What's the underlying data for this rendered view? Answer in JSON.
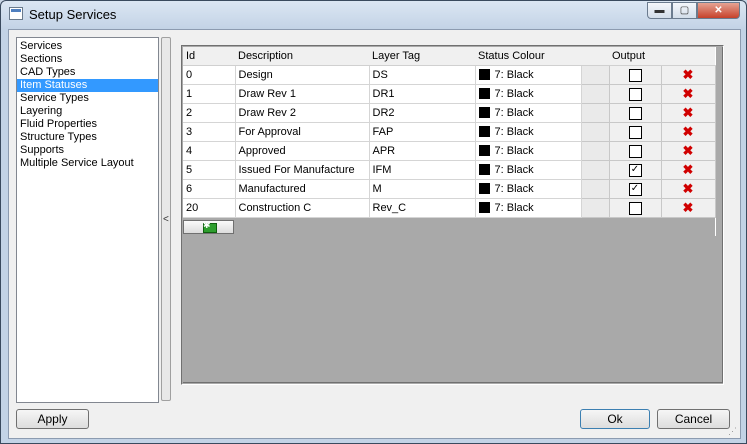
{
  "window": {
    "title": "Setup Services"
  },
  "caption": {
    "minimize": "▬",
    "maximize": "▢",
    "close": "✕"
  },
  "nav": {
    "items": [
      {
        "label": "Services",
        "selected": false
      },
      {
        "label": "Sections",
        "selected": false
      },
      {
        "label": "CAD Types",
        "selected": false
      },
      {
        "label": "Item Statuses",
        "selected": true
      },
      {
        "label": "Service Types",
        "selected": false
      },
      {
        "label": "Layering",
        "selected": false
      },
      {
        "label": "Fluid Properties",
        "selected": false
      },
      {
        "label": "Structure Types",
        "selected": false
      },
      {
        "label": "Supports",
        "selected": false
      },
      {
        "label": "Multiple Service Layout",
        "selected": false
      }
    ]
  },
  "splitter": {
    "glyph": "<"
  },
  "grid": {
    "headers": {
      "id": "Id",
      "description": "Description",
      "layer": "Layer Tag",
      "status": "Status Colour",
      "output": "Output"
    },
    "rows": [
      {
        "id": "0",
        "description": "Design",
        "layer": "DS",
        "colour": "7: Black",
        "output": false
      },
      {
        "id": "1",
        "description": "Draw Rev 1",
        "layer": "DR1",
        "colour": "7: Black",
        "output": false
      },
      {
        "id": "2",
        "description": "Draw Rev 2",
        "layer": "DR2",
        "colour": "7: Black",
        "output": false
      },
      {
        "id": "3",
        "description": "For Approval",
        "layer": "FAP",
        "colour": "7: Black",
        "output": false
      },
      {
        "id": "4",
        "description": "Approved",
        "layer": "APR",
        "colour": "7: Black",
        "output": false
      },
      {
        "id": "5",
        "description": "Issued For Manufacture",
        "layer": "IFM",
        "colour": "7: Black",
        "output": true
      },
      {
        "id": "6",
        "description": "Manufactured",
        "layer": "M",
        "colour": "7: Black",
        "output": true
      },
      {
        "id": "20",
        "description": "Construction C",
        "layer": "Rev_C",
        "colour": "7: Black",
        "output": false
      }
    ]
  },
  "colors": {
    "swatch": "#000000",
    "selection": "#3399ff",
    "delete": "#d00000"
  },
  "buttons": {
    "apply": "Apply",
    "ok": "Ok",
    "cancel": "Cancel"
  }
}
